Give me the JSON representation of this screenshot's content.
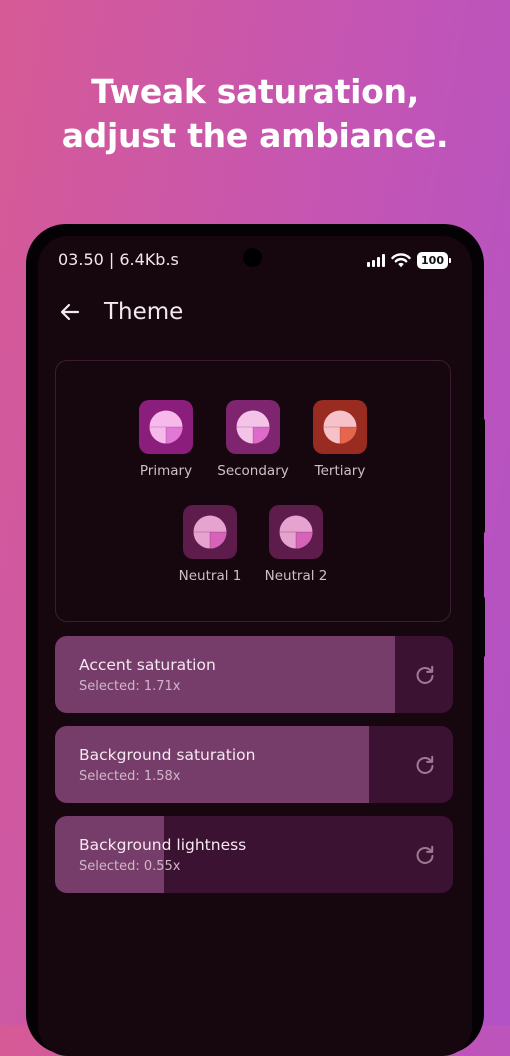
{
  "promo": {
    "line1": "Tweak saturation,",
    "line2": "adjust the ambiance."
  },
  "status_bar": {
    "time_speed": "03.50 | 6.4Kb.s",
    "battery": "100"
  },
  "app_bar": {
    "title": "Theme",
    "back_icon": "arrow-left-icon"
  },
  "palettes": [
    {
      "label": "Primary",
      "bg": "#8b1e7c",
      "light": "#f7b9eb",
      "dark": "#e079d6"
    },
    {
      "label": "Secondary",
      "bg": "#7f2570",
      "light": "#f4c3e8",
      "dark": "#de6ac9"
    },
    {
      "label": "Tertiary",
      "bg": "#9a2b20",
      "light": "#f6c1c8",
      "dark": "#e6654d"
    },
    {
      "label": "Neutral 1",
      "bg": "#5d1c4c",
      "light": "#e6a3cf",
      "dark": "#d763b8"
    },
    {
      "label": "Neutral 2",
      "bg": "#5d1c4c",
      "light": "#e6a3cf",
      "dark": "#d763b8"
    }
  ],
  "sliders": [
    {
      "title": "Accent saturation",
      "value_text": "Selected: 1.71x",
      "fill_fraction": 0.855
    },
    {
      "title": "Background saturation",
      "value_text": "Selected: 1.58x",
      "fill_fraction": 0.79
    },
    {
      "title": "Background lightness",
      "value_text": "Selected: 0.55x",
      "fill_fraction": 0.275
    }
  ],
  "colors": {
    "track": "#3c1232",
    "fill": "#763c6a",
    "screen_bg": "#16070f",
    "reset_icon": "refresh-icon"
  }
}
